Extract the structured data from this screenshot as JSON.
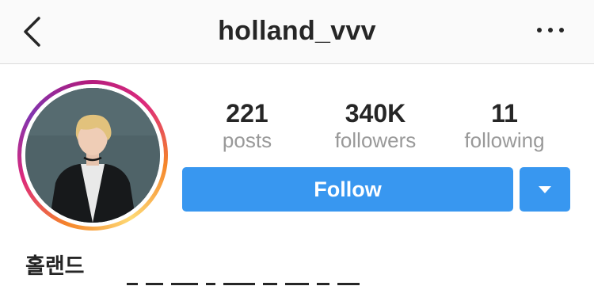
{
  "header": {
    "username": "holland_vvv",
    "back_icon": "chevron-left-icon",
    "more_icon": "more-horizontal-icon"
  },
  "profile": {
    "avatar_icon": "profile-photo",
    "display_name": "홀랜드"
  },
  "stats": {
    "posts": {
      "value": "221",
      "label": "posts"
    },
    "followers": {
      "value": "340K",
      "label": "followers"
    },
    "following": {
      "value": "11",
      "label": "following"
    }
  },
  "actions": {
    "follow_label": "Follow",
    "dropdown_icon": "caret-down-icon"
  },
  "colors": {
    "accent": "#3897f0",
    "text": "#262626",
    "muted": "#999999",
    "header_bg": "#fafafa"
  }
}
